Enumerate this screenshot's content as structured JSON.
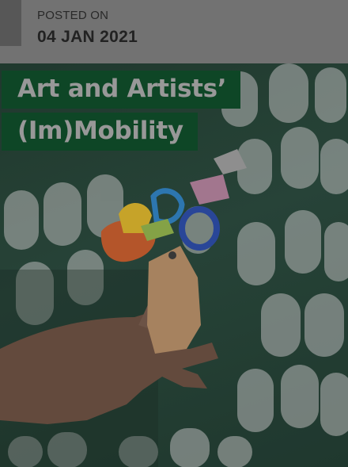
{
  "post": {
    "posted_label": "POSTED ON",
    "posted_date": "04 JAN 2021"
  },
  "article": {
    "title_line_1": "Art and Artists’",
    "title_line_2": "(Im)Mobility"
  },
  "colors": {
    "title_bg": "#0c4a26",
    "title_text": "#a5a5a5",
    "hero_bg": "#23443a"
  },
  "hero_image": {
    "subject": "hand holding paper craft figure on tag"
  }
}
